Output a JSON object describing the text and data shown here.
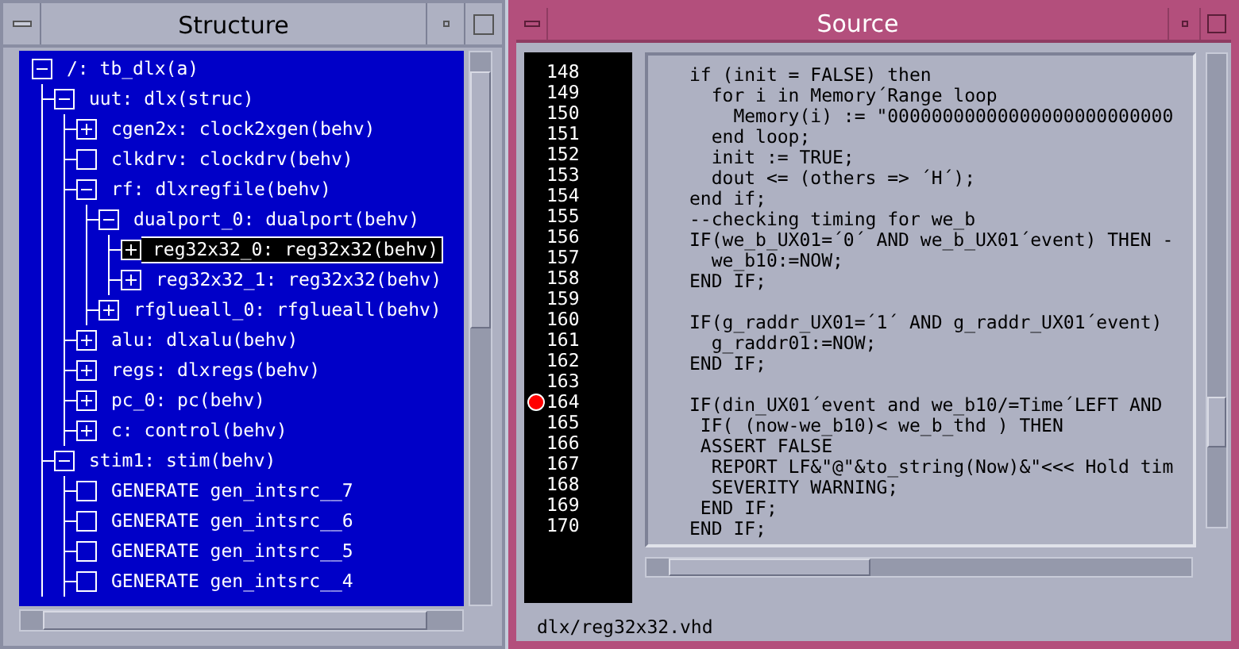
{
  "structure_window": {
    "title": "Structure",
    "tree": [
      {
        "label": "/: tb_dlx(a)",
        "kind": "minus",
        "selected": false,
        "children": [
          {
            "label": "uut: dlx(struc)",
            "kind": "minus",
            "selected": false,
            "children": [
              {
                "label": "cgen2x: clock2xgen(behv)",
                "kind": "plus",
                "selected": false
              },
              {
                "label": "clkdrv: clockdrv(behv)",
                "kind": "none",
                "selected": false
              },
              {
                "label": "rf: dlxregfile(behv)",
                "kind": "minus",
                "selected": false,
                "children": [
                  {
                    "label": "dualport_0: dualport(behv)",
                    "kind": "minus",
                    "selected": false,
                    "children": [
                      {
                        "label": "reg32x32_0: reg32x32(behv)",
                        "kind": "plus",
                        "selected": true
                      },
                      {
                        "label": "reg32x32_1: reg32x32(behv)",
                        "kind": "plus",
                        "selected": false
                      }
                    ]
                  },
                  {
                    "label": "rfglueall_0: rfglueall(behv)",
                    "kind": "plus",
                    "selected": false
                  }
                ]
              },
              {
                "label": "alu: dlxalu(behv)",
                "kind": "plus",
                "selected": false
              },
              {
                "label": "regs: dlxregs(behv)",
                "kind": "plus",
                "selected": false
              },
              {
                "label": "pc_0: pc(behv)",
                "kind": "plus",
                "selected": false
              },
              {
                "label": "c: control(behv)",
                "kind": "plus",
                "selected": false
              }
            ]
          },
          {
            "label": "stim1: stim(behv)",
            "kind": "minus",
            "selected": false,
            "children": [
              {
                "label": "GENERATE gen_intsrc__7",
                "kind": "none",
                "selected": false
              },
              {
                "label": "GENERATE gen_intsrc__6",
                "kind": "none",
                "selected": false
              },
              {
                "label": "GENERATE gen_intsrc__5",
                "kind": "none",
                "selected": false
              },
              {
                "label": "GENERATE gen_intsrc__4",
                "kind": "none",
                "selected": false
              }
            ]
          }
        ]
      }
    ]
  },
  "source_window": {
    "title": "Source",
    "lines": [
      {
        "number": "148",
        "text": "if (init = FALSE) then",
        "breakpoint": false
      },
      {
        "number": "149",
        "text": "  for i in Memory´Range loop",
        "breakpoint": false
      },
      {
        "number": "150",
        "text": "    Memory(i) := \"00000000000000000000000000",
        "breakpoint": false
      },
      {
        "number": "151",
        "text": "  end loop;",
        "breakpoint": false
      },
      {
        "number": "152",
        "text": "  init := TRUE;",
        "breakpoint": false
      },
      {
        "number": "153",
        "text": "  dout <= (others => ´H´);",
        "breakpoint": false
      },
      {
        "number": "154",
        "text": "end if;",
        "breakpoint": false
      },
      {
        "number": "155",
        "text": "--checking timing for we_b",
        "breakpoint": false
      },
      {
        "number": "156",
        "text": "IF(we_b_UX01=´0´ AND we_b_UX01´event) THEN -",
        "breakpoint": false
      },
      {
        "number": "157",
        "text": "  we_b10:=NOW;",
        "breakpoint": false
      },
      {
        "number": "158",
        "text": "END IF;",
        "breakpoint": false
      },
      {
        "number": "159",
        "breakpoint": false
      },
      {
        "number": "160",
        "text": "IF(g_raddr_UX01=´1´ AND g_raddr_UX01´event)",
        "breakpoint": false
      },
      {
        "number": "161",
        "text": "  g_raddr01:=NOW;",
        "breakpoint": false
      },
      {
        "number": "162",
        "text": "END IF;",
        "breakpoint": false
      },
      {
        "number": "163",
        "breakpoint": false
      },
      {
        "number": "164",
        "text": "IF(din_UX01´event and we_b10/=Time´LEFT AND",
        "breakpoint": true
      },
      {
        "number": "165",
        "text": " IF( (now-we_b10)< we_b_thd ) THEN",
        "breakpoint": false
      },
      {
        "number": "166",
        "text": " ASSERT FALSE",
        "breakpoint": false
      },
      {
        "number": "167",
        "text": "  REPORT LF&\"@\"&to_string(Now)&\"<<< Hold tim",
        "breakpoint": false
      },
      {
        "number": "168",
        "text": "  SEVERITY WARNING;",
        "breakpoint": false
      },
      {
        "number": "169",
        "text": " END IF;",
        "breakpoint": false
      },
      {
        "number": "170",
        "text": "END IF;",
        "breakpoint": false
      }
    ],
    "file_path": "dlx/reg32x32.vhd"
  }
}
